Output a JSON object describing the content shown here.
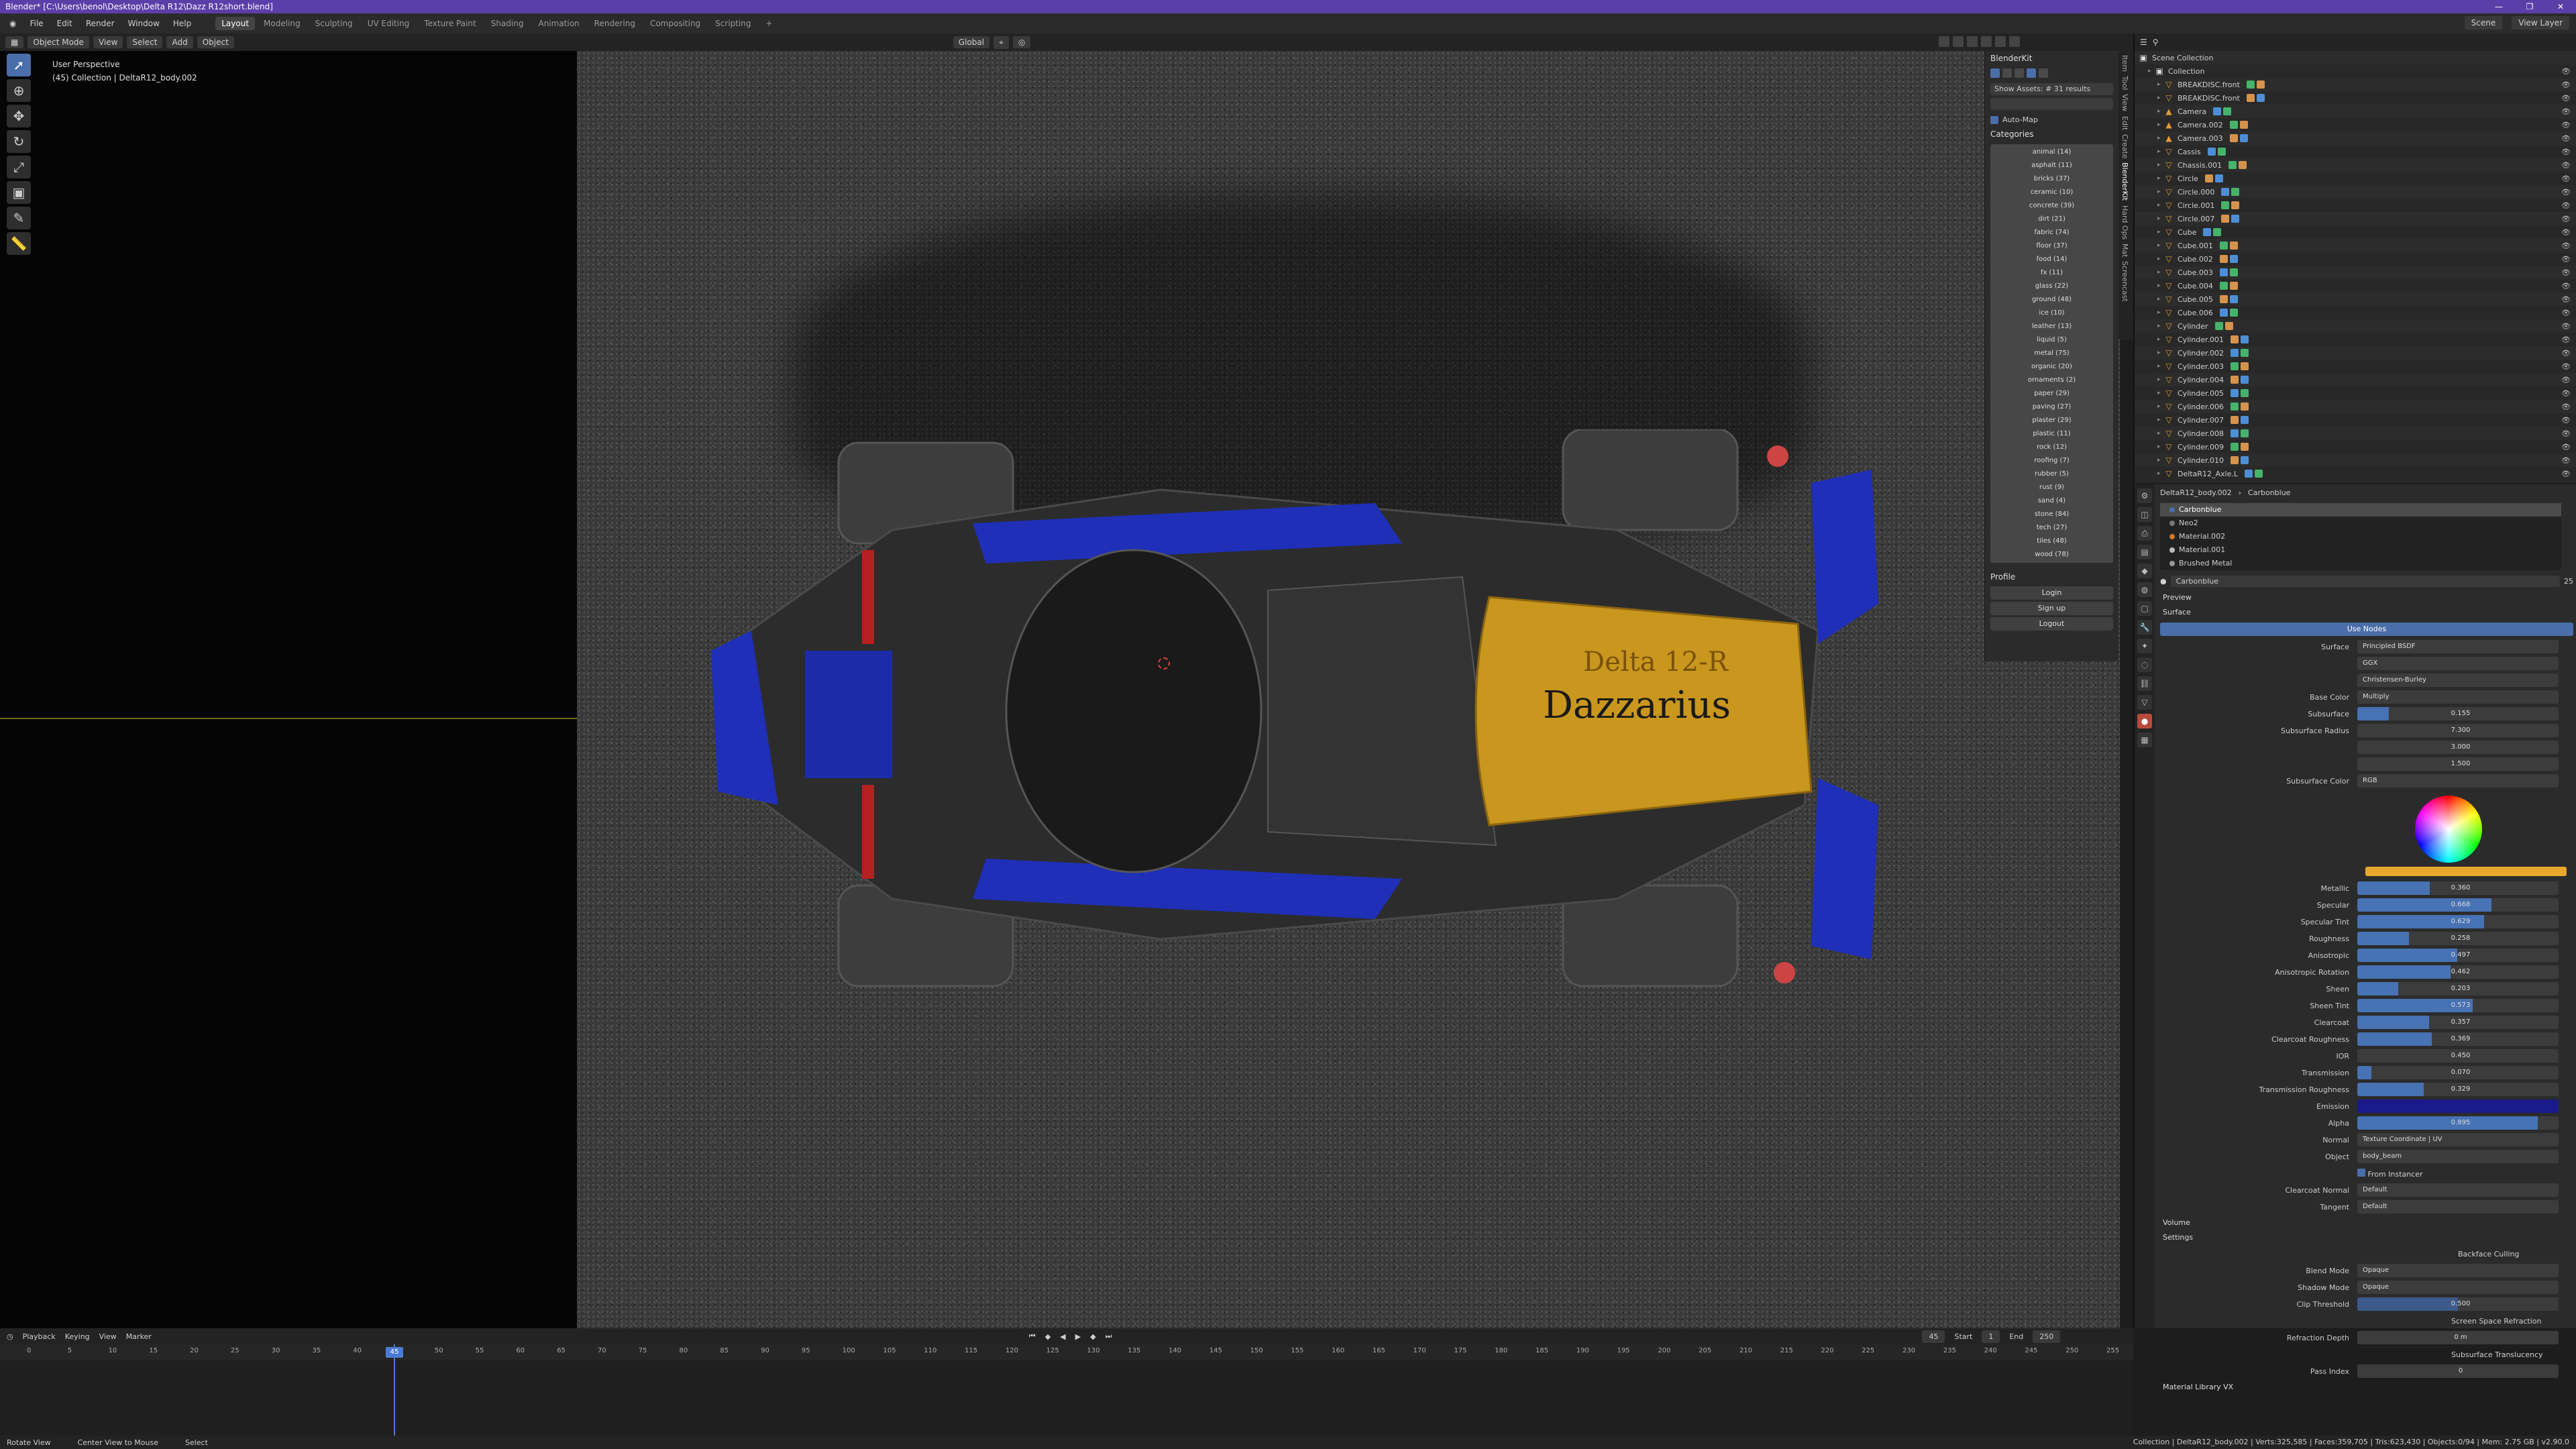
{
  "title": "Blender* [C:\\Users\\benol\\Desktop\\Delta R12\\Dazz R12short.blend]",
  "window_controls": [
    "—",
    "❐",
    "✕"
  ],
  "menu": [
    "File",
    "Edit",
    "Render",
    "Window",
    "Help"
  ],
  "workspaces": [
    "Layout",
    "Modeling",
    "Sculpting",
    "UV Editing",
    "Texture Paint",
    "Shading",
    "Animation",
    "Rendering",
    "Compositing",
    "Scripting",
    "+"
  ],
  "scene_label": "Scene",
  "view_layer_label": "View Layer",
  "viewport": {
    "mode": "Object Mode",
    "menus": [
      "View",
      "Select",
      "Add",
      "Object"
    ],
    "orientation": "Global",
    "perspective": "User Perspective",
    "collection": "(45) Collection | DeltaR12_body.002",
    "car_name_1": "Delta 12-R",
    "car_name_2": "Dazzarius"
  },
  "nav_tabs": [
    "Item",
    "Tool",
    "View",
    "Edit",
    "Create",
    "BlenderKit",
    "Hard Ops",
    "Mat",
    "Screencast"
  ],
  "blenderkit": {
    "title": "BlenderKit",
    "search_mode": "Show Assets: # 31 results",
    "automap": "Auto-Map",
    "categories_title": "Categories",
    "categories": [
      "animal (14)",
      "asphalt (11)",
      "bricks (37)",
      "ceramic (10)",
      "concrete (39)",
      "dirt (21)",
      "fabric (74)",
      "floor (37)",
      "food (14)",
      "fx (11)",
      "glass (22)",
      "ground (48)",
      "ice (10)",
      "leather (13)",
      "liquid (5)",
      "metal (75)",
      "organic (20)",
      "ornaments (2)",
      "paper (29)",
      "paving (27)",
      "plaster (29)",
      "plastic (11)",
      "rock (12)",
      "roofing (7)",
      "rubber (5)",
      "rust (9)",
      "sand (4)",
      "stone (84)",
      "tech (27)",
      "tiles (48)",
      "wood (78)"
    ],
    "profile_title": "Profile",
    "profile_buttons": [
      "Login",
      "Sign up",
      "Logout"
    ]
  },
  "outliner": {
    "title": "Scene Collection",
    "items": [
      {
        "name": "Collection",
        "level": 1,
        "icon": "collection-icon"
      },
      {
        "name": "BREAKDISC.front",
        "level": 2,
        "icon": "mesh-icon"
      },
      {
        "name": "BREAKDISC.front",
        "level": 2,
        "icon": "mesh-icon"
      },
      {
        "name": "Camera",
        "level": 2,
        "icon": "camera-icon"
      },
      {
        "name": "Camera.002",
        "level": 2,
        "icon": "camera-icon"
      },
      {
        "name": "Camera.003",
        "level": 2,
        "icon": "camera-icon"
      },
      {
        "name": "Cassis",
        "level": 2,
        "icon": "mesh-icon"
      },
      {
        "name": "Chassis.001",
        "level": 2,
        "icon": "mesh-icon"
      },
      {
        "name": "Circle",
        "level": 2,
        "icon": "mesh-icon"
      },
      {
        "name": "Circle.000",
        "level": 2,
        "icon": "mesh-icon"
      },
      {
        "name": "Circle.001",
        "level": 2,
        "icon": "mesh-icon"
      },
      {
        "name": "Circle.007",
        "level": 2,
        "icon": "mesh-icon"
      },
      {
        "name": "Cube",
        "level": 2,
        "icon": "mesh-icon"
      },
      {
        "name": "Cube.001",
        "level": 2,
        "icon": "mesh-icon"
      },
      {
        "name": "Cube.002",
        "level": 2,
        "icon": "mesh-icon"
      },
      {
        "name": "Cube.003",
        "level": 2,
        "icon": "mesh-icon"
      },
      {
        "name": "Cube.004",
        "level": 2,
        "icon": "mesh-icon"
      },
      {
        "name": "Cube.005",
        "level": 2,
        "icon": "mesh-icon"
      },
      {
        "name": "Cube.006",
        "level": 2,
        "icon": "mesh-icon"
      },
      {
        "name": "Cylinder",
        "level": 2,
        "icon": "mesh-icon"
      },
      {
        "name": "Cylinder.001",
        "level": 2,
        "icon": "mesh-icon"
      },
      {
        "name": "Cylinder.002",
        "level": 2,
        "icon": "mesh-icon"
      },
      {
        "name": "Cylinder.003",
        "level": 2,
        "icon": "mesh-icon"
      },
      {
        "name": "Cylinder.004",
        "level": 2,
        "icon": "mesh-icon"
      },
      {
        "name": "Cylinder.005",
        "level": 2,
        "icon": "mesh-icon"
      },
      {
        "name": "Cylinder.006",
        "level": 2,
        "icon": "mesh-icon"
      },
      {
        "name": "Cylinder.007",
        "level": 2,
        "icon": "mesh-icon"
      },
      {
        "name": "Cylinder.008",
        "level": 2,
        "icon": "mesh-icon"
      },
      {
        "name": "Cylinder.009",
        "level": 2,
        "icon": "mesh-icon"
      },
      {
        "name": "Cylinder.010",
        "level": 2,
        "icon": "mesh-icon"
      },
      {
        "name": "DeltaR12_Axle.L",
        "level": 2,
        "icon": "mesh-icon"
      }
    ]
  },
  "properties": {
    "breadcrumb_object": "DeltaR12_body.002",
    "breadcrumb_material": "Carbonblue",
    "slots": [
      "Carbonblue",
      "Neo2",
      "Material.002",
      "Material.001",
      "Brushed Metal"
    ],
    "slot_colors": [
      "#4a6ea9",
      "#777777",
      "#d07a2a",
      "#bbbbbb",
      "#999999"
    ],
    "material_name": "Carbonblue",
    "material_users": "25",
    "section_preview": "Preview",
    "section_surface": "Surface",
    "use_nodes": "Use Nodes",
    "surface_label": "Surface",
    "surface_value": "Principled BSDF",
    "distribution": "GGX",
    "subsurface_method": "Christensen-Burley",
    "base_color_label": "Base Color",
    "base_color_value": "Multiply",
    "subsurface_label": "Subsurface",
    "subsurface_value": "0.155",
    "subsurface_radius_label": "Subsurface Radius",
    "subsurface_radius": [
      "7.300",
      "3.000",
      "1.500"
    ],
    "subsurface_color_label": "Subsurface Color",
    "subsurface_color_value": "RGB",
    "sliders": [
      {
        "label": "Metallic",
        "value": "0.360",
        "fraction": 0.36
      },
      {
        "label": "Specular",
        "value": "0.668",
        "fraction": 0.668
      },
      {
        "label": "Specular Tint",
        "value": "0.629",
        "fraction": 0.629
      },
      {
        "label": "Roughness",
        "value": "0.258",
        "fraction": 0.258
      },
      {
        "label": "Anisotropic",
        "value": "0.497",
        "fraction": 0.497
      },
      {
        "label": "Anisotropic Rotation",
        "value": "0.462",
        "fraction": 0.462
      },
      {
        "label": "Sheen",
        "value": "0.203",
        "fraction": 0.203
      },
      {
        "label": "Sheen Tint",
        "value": "0.573",
        "fraction": 0.573
      },
      {
        "label": "Clearcoat",
        "value": "0.357",
        "fraction": 0.357
      },
      {
        "label": "Clearcoat Roughness",
        "value": "0.369",
        "fraction": 0.369
      },
      {
        "label": "IOR",
        "value": "0.450",
        "fraction": 0
      },
      {
        "label": "Transmission",
        "value": "0.070",
        "fraction": 0.07
      },
      {
        "label": "Transmission Roughness",
        "value": "0.329",
        "fraction": 0.329
      },
      {
        "label": "Emission",
        "value": "",
        "fraction": 1
      },
      {
        "label": "Alpha",
        "value": "0.895",
        "fraction": 0.895
      }
    ],
    "normal_label": "Normal",
    "normal_value": "Texture Coordinate | UV",
    "object_label": "Object",
    "object_value": "body_beam",
    "from_instancer": "From Instancer",
    "clearcoat_normal_label": "Clearcoat Normal",
    "clearcoat_normal_value": "Default",
    "tangent_label": "Tangent",
    "tangent_value": "Default",
    "section_volume": "Volume",
    "section_settings": "Settings",
    "backface": "Backface Culling",
    "blend_mode_label": "Blend Mode",
    "blend_mode_value": "Opaque",
    "shadow_mode_label": "Shadow Mode",
    "shadow_mode_value": "Opaque",
    "clip_threshold_label": "Clip Threshold",
    "clip_threshold_value": "0.500",
    "ssr": "Screen Space Refraction",
    "refraction_depth_label": "Refraction Depth",
    "refraction_depth_value": "0 m",
    "subsurface_translucency": "Subsurface Translucency",
    "pass_index_label": "Pass Index",
    "pass_index_value": "0",
    "section_library": "Material Library VX"
  },
  "timeline": {
    "menus": [
      "Playback",
      "Keying",
      "View",
      "Marker"
    ],
    "current_frame": "45",
    "start_label": "Start",
    "start": "1",
    "end_label": "End",
    "end": "250",
    "ticks": [
      "0",
      "5",
      "10",
      "15",
      "20",
      "25",
      "30",
      "35",
      "40",
      "45",
      "50",
      "55",
      "60",
      "65",
      "70",
      "75",
      "80",
      "85",
      "90",
      "95",
      "100",
      "105",
      "110",
      "115",
      "120",
      "125",
      "130",
      "135",
      "140",
      "145",
      "150",
      "155",
      "160",
      "165",
      "170",
      "175",
      "180",
      "185",
      "190",
      "195",
      "200",
      "205",
      "210",
      "215",
      "220",
      "225",
      "230",
      "235",
      "240",
      "245",
      "250",
      "255"
    ]
  },
  "status": {
    "left1": "Rotate View",
    "left2": "Center View to Mouse",
    "left3": "Select",
    "right": "Collection | DeltaR12_body.002 | Verts:325,585 | Faces:359,705 | Tris:623,430 | Objects:0/94 | Mem: 2.75 GB | v2.90.0"
  },
  "colors": {
    "accent": "#4772b3",
    "titlebar": "#5b3fa8",
    "car_blue": "#1f2fb8",
    "car_gold": "#c9961e"
  }
}
